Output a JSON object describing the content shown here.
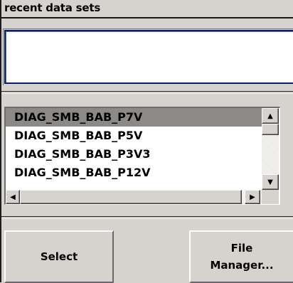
{
  "panel": {
    "title": "recent data sets"
  },
  "recent_input": {
    "value": ""
  },
  "file_list": {
    "items": [
      {
        "label": "DIAG_SMB_BAB_P7V",
        "selected": true
      },
      {
        "label": "DIAG_SMB_BAB_P5V",
        "selected": false
      },
      {
        "label": "DIAG_SMB_BAB_P3V3",
        "selected": false
      },
      {
        "label": "DIAG_SMB_BAB_P12V",
        "selected": false
      }
    ]
  },
  "scrollbar": {
    "up_icon": "arrow-up-icon",
    "down_icon": "arrow-down-icon",
    "left_icon": "arrow-left-icon",
    "right_icon": "arrow-right-icon",
    "up_glyph": "▲",
    "down_glyph": "▼",
    "left_glyph": "◀",
    "right_glyph": "▶"
  },
  "buttons": {
    "select_label": "Select",
    "file_manager_line1": "File",
    "file_manager_line2": "Manager..."
  },
  "colors": {
    "background": "#d6d3ce",
    "selection": "#8c8a86",
    "input_border": "#0a1e6e"
  }
}
